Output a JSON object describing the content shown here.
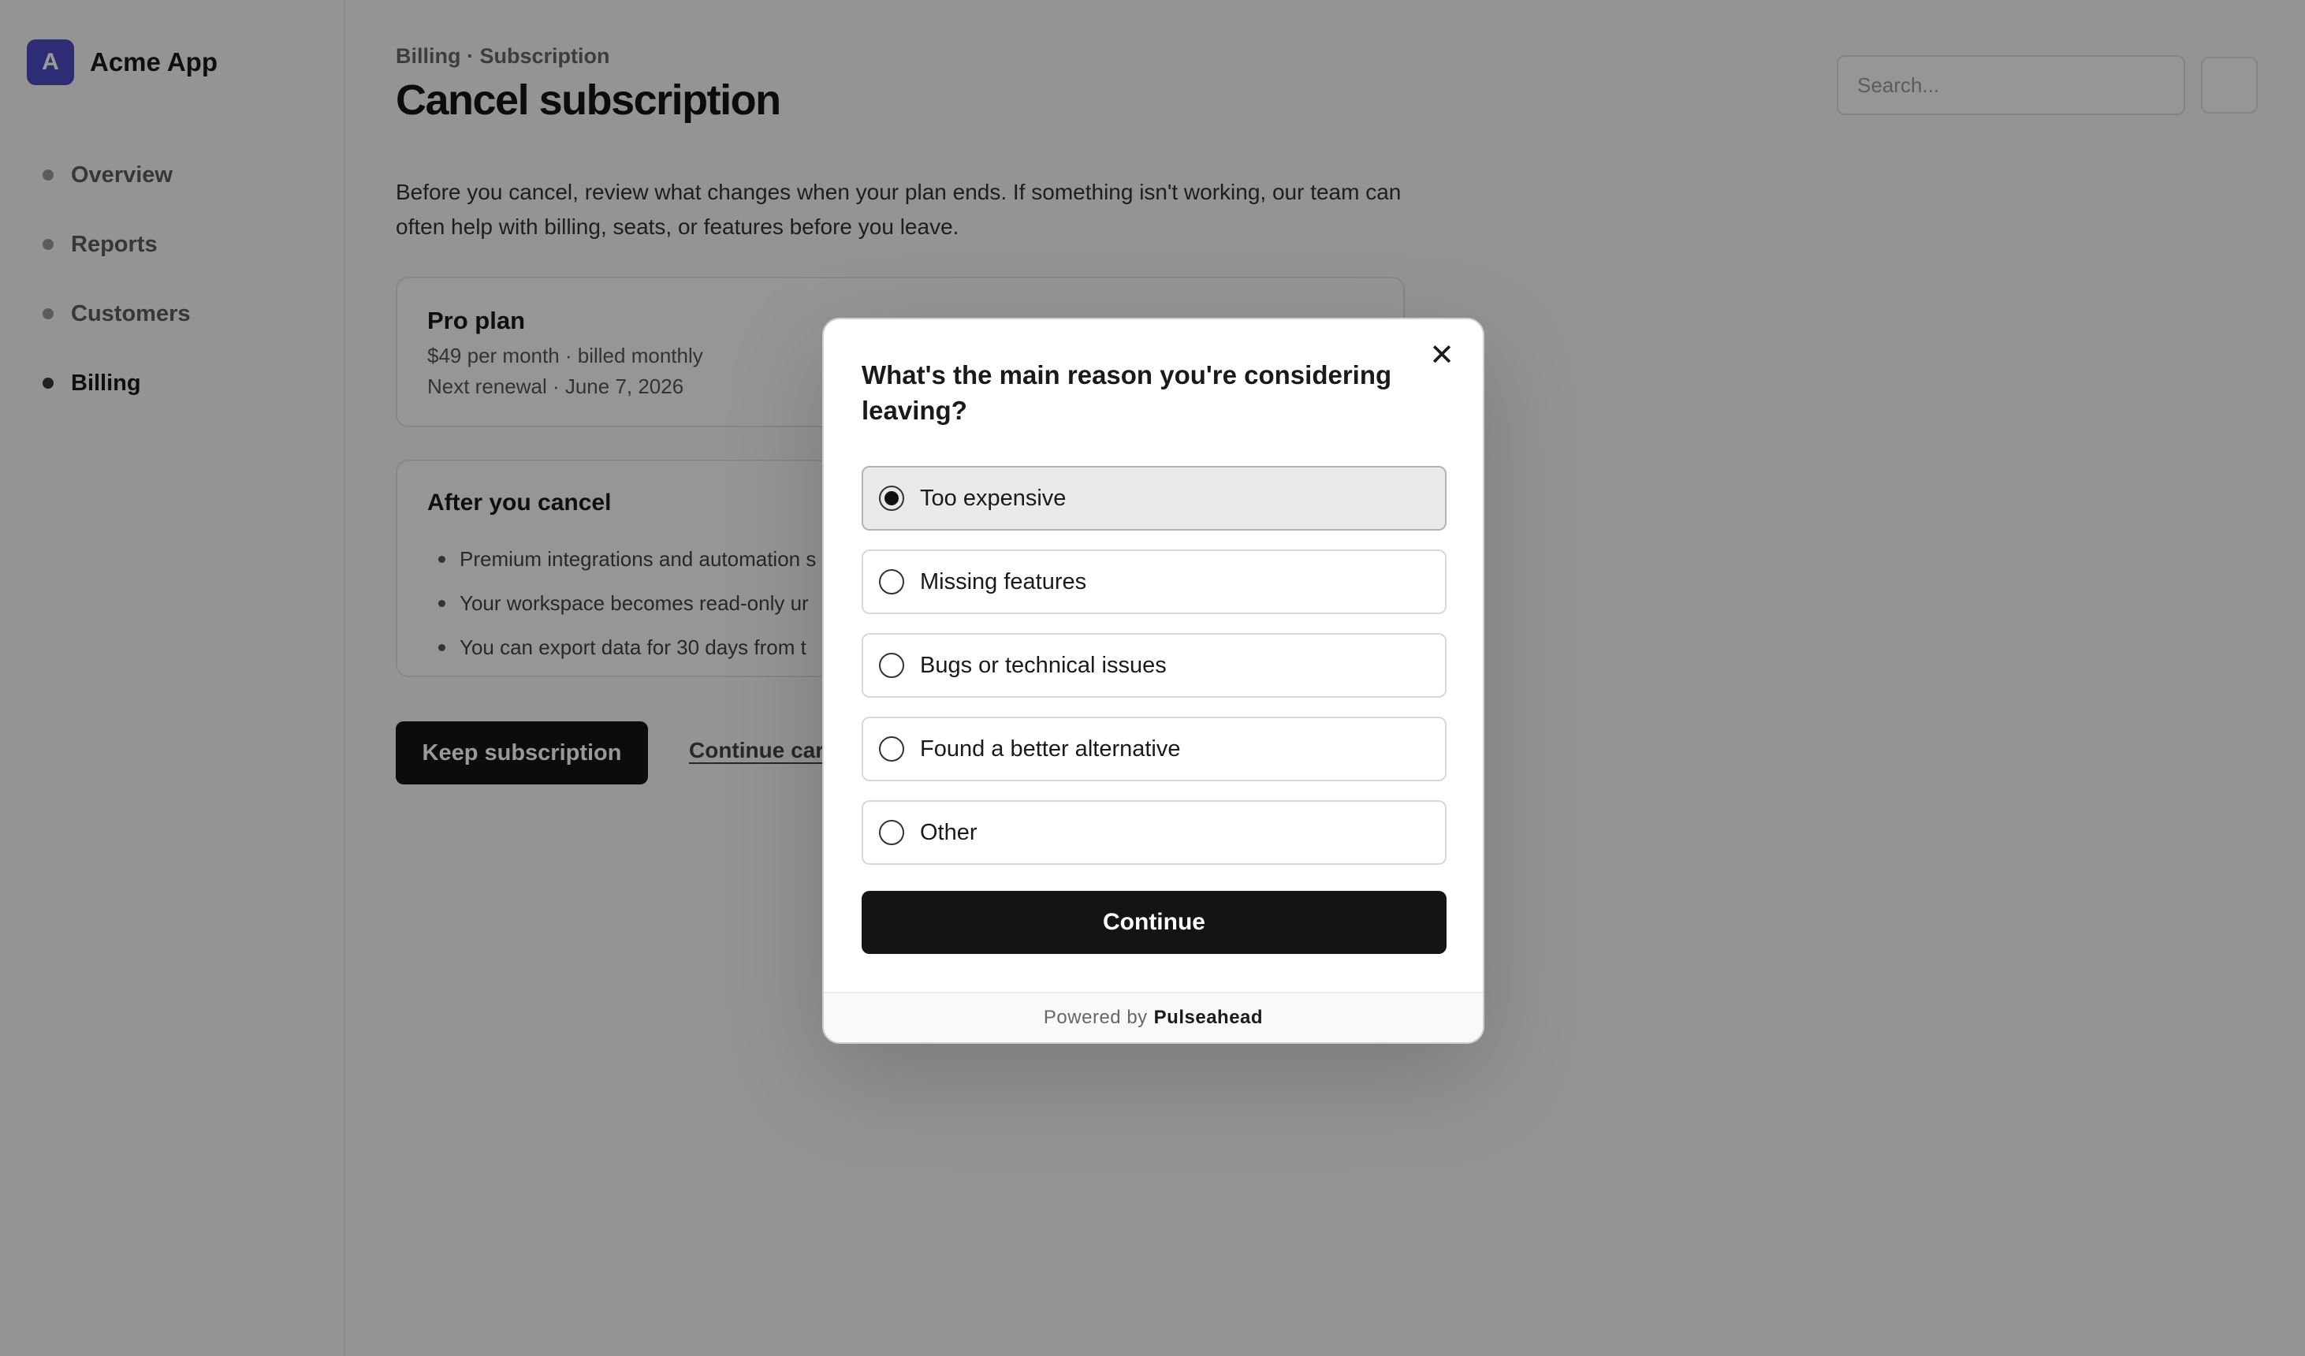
{
  "app": {
    "logo_letter": "A",
    "name": "Acme App",
    "logo_color": "#4e4ac2"
  },
  "sidebar": {
    "items": [
      {
        "label": "Overview",
        "active": false
      },
      {
        "label": "Reports",
        "active": false
      },
      {
        "label": "Customers",
        "active": false
      },
      {
        "label": "Billing",
        "active": true
      }
    ]
  },
  "header": {
    "breadcrumb": "Billing · Subscription",
    "title": "Cancel subscription",
    "search_placeholder": "Search..."
  },
  "intro": "Before you cancel, review what changes when your plan ends. If something isn't working, our team can often help with billing, seats, or features before you leave.",
  "plan": {
    "name": "Pro plan",
    "price_line": "$49 per month · billed monthly",
    "renewal_line": "Next renewal · June 7, 2026"
  },
  "after_cancel": {
    "title": "After you cancel",
    "items": [
      "Premium integrations and automation s",
      "Your workspace becomes read-only ur",
      "You can export data for 30 days from t"
    ]
  },
  "actions": {
    "keep_label": "Keep subscription",
    "continue_link": "Continue car"
  },
  "modal": {
    "close_glyph": "✕",
    "question": "What's the main reason you're considering leaving?",
    "options": [
      {
        "label": "Too expensive",
        "selected": true
      },
      {
        "label": "Missing features",
        "selected": false
      },
      {
        "label": "Bugs or technical issues",
        "selected": false
      },
      {
        "label": "Found a better alternative",
        "selected": false
      },
      {
        "label": "Other",
        "selected": false
      }
    ],
    "continue_label": "Continue",
    "footer_prefix": "Powered by",
    "footer_brand": "Pulseahead"
  }
}
